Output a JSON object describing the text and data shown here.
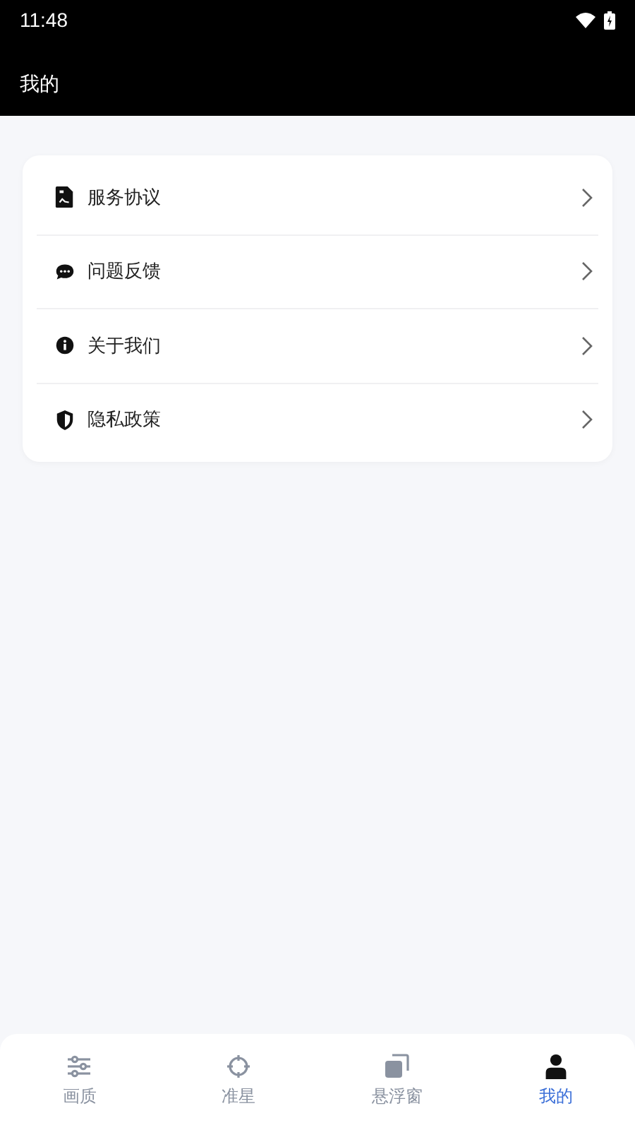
{
  "status_bar": {
    "time": "11:48"
  },
  "header": {
    "title": "我的"
  },
  "menu": [
    {
      "kind": "document",
      "label": "服务协议"
    },
    {
      "kind": "chat",
      "label": "问题反馈"
    },
    {
      "kind": "info",
      "label": "关于我们"
    },
    {
      "kind": "shield",
      "label": "隐私政策"
    }
  ],
  "tabs": [
    {
      "kind": "sliders",
      "label": "画质",
      "selected": false
    },
    {
      "kind": "crosshair",
      "label": "准星",
      "selected": false
    },
    {
      "kind": "windows",
      "label": "悬浮窗",
      "selected": false
    },
    {
      "kind": "person",
      "label": "我的",
      "selected": true
    }
  ]
}
